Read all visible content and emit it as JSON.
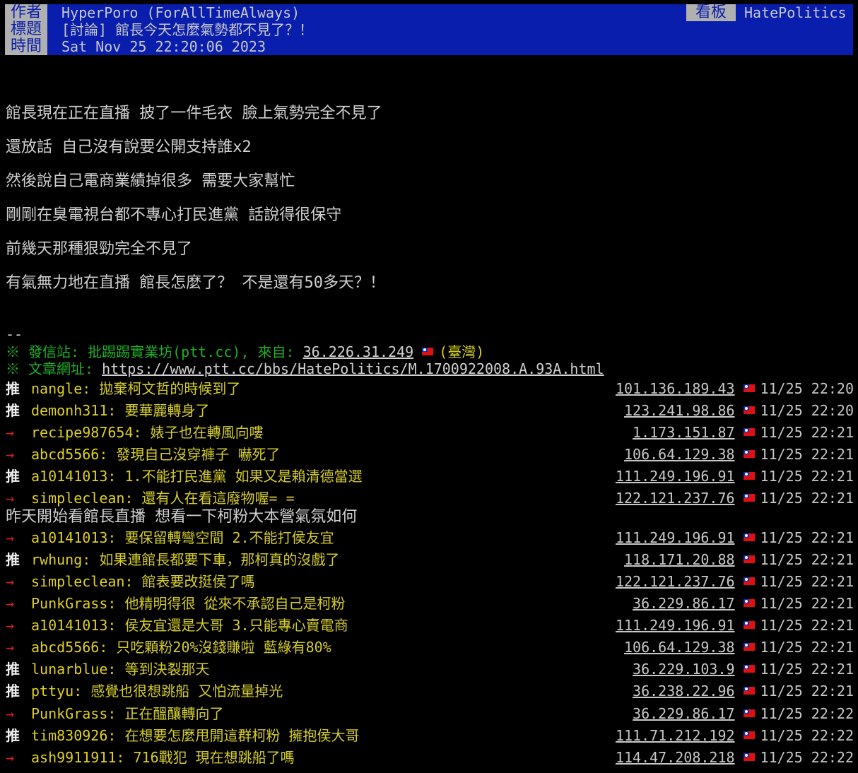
{
  "header": {
    "author_key": "作者",
    "author": "HyperPoro (ForAllTimeAlways)",
    "title_key": "標題",
    "title": "[討論] 館長今天怎麼氣勢都不見了？！",
    "time_key": "時間",
    "time": "Sat Nov 25 22:20:06 2023",
    "board_key": "看板",
    "board": "HatePolitics"
  },
  "body": [
    "館長現在正在直播 披了一件毛衣 臉上氣勢完全不見了",
    "還放話 自己沒有說要公開支持誰x2",
    "然後說自己電商業績掉很多 需要大家幫忙",
    "剛剛在臭電視台都不專心打民進黨 話說得很保守",
    "前幾天那種狠勁完全不見了",
    "有氣無力地在直播 館長怎麼了？ 不是還有50多天？！"
  ],
  "signature": "--",
  "source": {
    "prefix": "※ 發信站: 批踢踢實業坊(ptt.cc), 來自: ",
    "ip": "36.226.31.249",
    "location": "(臺灣)",
    "url_prefix": "※ 文章網址: ",
    "url": "https://www.ptt.cc/bbs/HatePolitics/M.1700922008.A.93A.html"
  },
  "pushes": [
    {
      "tag": "推",
      "type": "push",
      "user": "nangle",
      "msg": "拋棄柯文哲的時候到了",
      "ip": "101.136.189.43",
      "time": "11/25 22:20"
    },
    {
      "tag": "推",
      "type": "push",
      "user": "demonh311",
      "msg": "要華麗轉身了",
      "ip": "123.241.98.86",
      "time": "11/25 22:20"
    },
    {
      "tag": "→",
      "type": "arrow",
      "user": "recipe987654",
      "msg": "婊子也在轉風向嘍",
      "ip": "1.173.151.87",
      "time": "11/25 22:21"
    },
    {
      "tag": "→",
      "type": "arrow",
      "user": "abcd5566",
      "msg": "發現自己沒穿褲子  嚇死了",
      "ip": "106.64.129.38",
      "time": "11/25 22:21"
    },
    {
      "tag": "推",
      "type": "push",
      "user": "a10141013",
      "msg": "1.不能打民進黨 如果又是賴清德當選",
      "ip": "111.249.196.91",
      "time": "11/25 22:21"
    },
    {
      "tag": "→",
      "type": "arrow",
      "user": "simpleclean",
      "msg": "還有人在看這廢物喔= =",
      "ip": "122.121.237.76",
      "time": "11/25 22:21"
    },
    {
      "tag": "→",
      "type": "arrow",
      "user": "a10141013",
      "msg": "要保留轉彎空間 2.不能打侯友宜",
      "ip": "111.249.196.91",
      "time": "11/25 22:21"
    },
    {
      "tag": "推",
      "type": "push",
      "user": "rwhung",
      "msg": "如果連館長都要下車，那柯真的沒戲了",
      "ip": "118.171.20.88",
      "time": "11/25 22:21"
    },
    {
      "tag": "→",
      "type": "arrow",
      "user": "simpleclean",
      "msg": "館表要改挺侯了嗎",
      "ip": "122.121.237.76",
      "time": "11/25 22:21"
    },
    {
      "tag": "→",
      "type": "arrow",
      "user": "PunkGrass",
      "msg": "他精明得很 從來不承認自己是柯粉",
      "ip": "36.229.86.17",
      "time": "11/25 22:21"
    },
    {
      "tag": "→",
      "type": "arrow",
      "user": "a10141013",
      "msg": "侯友宜還是大哥 3.只能專心賣電商",
      "ip": "111.249.196.91",
      "time": "11/25 22:21"
    },
    {
      "tag": "→",
      "type": "arrow",
      "user": "abcd5566",
      "msg": "只吃顆粉20%沒錢賺啦 藍綠有80%",
      "ip": "106.64.129.38",
      "time": "11/25 22:21"
    },
    {
      "tag": "推",
      "type": "push",
      "user": "lunarblue",
      "msg": "等到決裂那天",
      "ip": "36.229.103.9",
      "time": "11/25 22:21"
    },
    {
      "tag": "推",
      "type": "push",
      "user": "pttyu",
      "msg": "感覺也很想跳船 又怕流量掉光",
      "ip": "36.238.22.96",
      "time": "11/25 22:21"
    },
    {
      "tag": "→",
      "type": "arrow",
      "user": "PunkGrass",
      "msg": "正在醞釀轉向了",
      "ip": "36.229.86.17",
      "time": "11/25 22:22"
    },
    {
      "tag": "推",
      "type": "push",
      "user": "tim830926",
      "msg": "在想要怎麼甩開這群柯粉 擁抱侯大哥",
      "ip": "111.71.212.192",
      "time": "11/25 22:22"
    },
    {
      "tag": "→",
      "type": "arrow",
      "user": "ash9911911",
      "msg": "716戰犯 現在想跳船了嗎",
      "ip": "114.47.208.218",
      "time": "11/25 22:22"
    }
  ],
  "interjection": "昨天開始看館長直播 想看一下柯粉大本營氣氛如何"
}
